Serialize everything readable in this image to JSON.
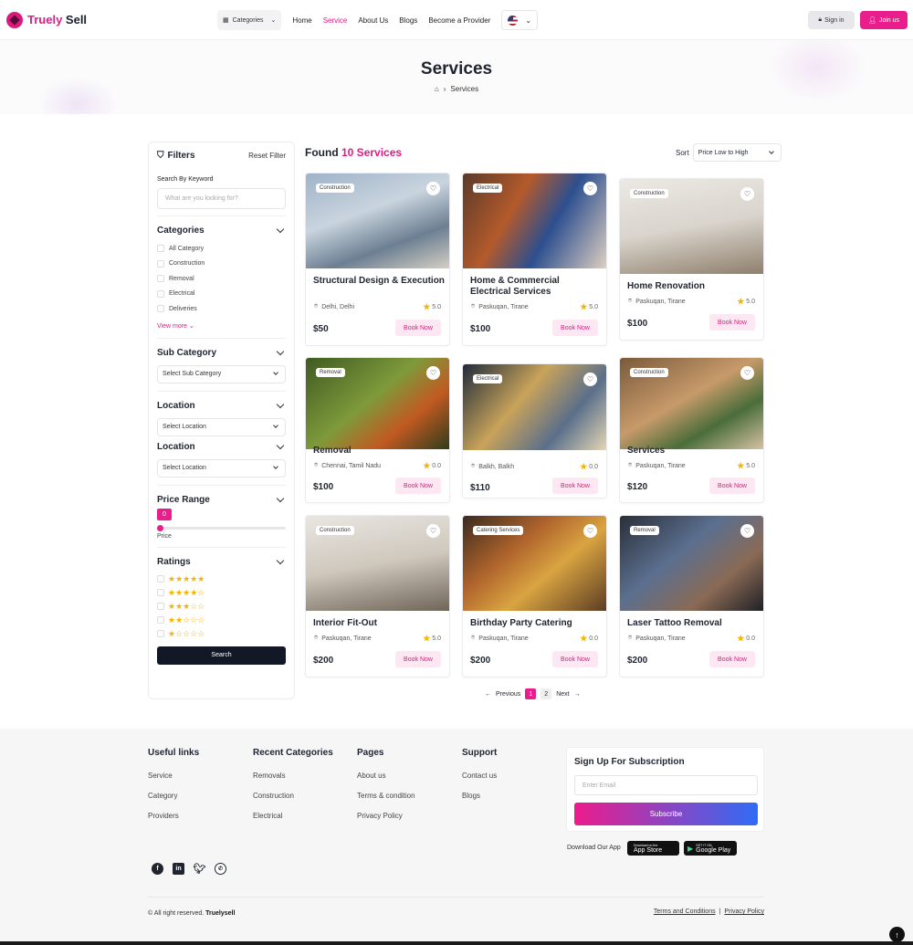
{
  "header": {
    "logo_text_1": "Truely",
    "logo_text_2": "Sell",
    "categories_label": "Categories",
    "nav": [
      "Home",
      "Service",
      "About Us",
      "Blogs",
      "Become a Provider"
    ],
    "signin": "Sign in",
    "joinus": "Join us"
  },
  "hero": {
    "title": "Services",
    "breadcrumb": "Services"
  },
  "filters": {
    "title": "Filters",
    "reset": "Reset Filter",
    "keyword_label": "Search By Keyword",
    "keyword_placeholder": "What are you looking for?",
    "categories_title": "Categories",
    "categories": [
      "All Category",
      "Construction",
      "Removal",
      "Electrical",
      "Deliveries"
    ],
    "view_more": "View more",
    "subcategory_title": "Sub Category",
    "subcategory_select": "Select Sub Category",
    "location_title_1": "Location",
    "location_select_1": "Select Location",
    "location_title_2": "Location",
    "location_select_2": "Select Location",
    "price_title": "Price Range",
    "price_value": "0",
    "price_fraction": 0,
    "price_label": "Price",
    "ratings_title": "Ratings",
    "ratings": [
      "★★★★★",
      "★★★★☆",
      "★★★☆☆",
      "★★☆☆☆",
      "★☆☆☆☆"
    ],
    "search": "Search"
  },
  "results": {
    "found_prefix": "Found",
    "found_count": "10 Services",
    "sort_label": "Sort",
    "sort_value": "Price Low to High"
  },
  "cards": [
    {
      "tag": "Construction",
      "title": "Structural Design & Execution",
      "location": "Delhi, Delhi",
      "rating": "5.0",
      "price": "$50",
      "book": "Book Now"
    },
    {
      "tag": "Electrical",
      "title": "Home & Commercial Electrical Services",
      "location": "Paskuqan, Tirane",
      "rating": "5.0",
      "price": "$100",
      "book": "Book Now"
    },
    {
      "tag": "Construction",
      "title": "Home Renovation",
      "location": "Paskuqan, Tirane",
      "rating": "5.0",
      "price": "$100",
      "book": "Book Now"
    },
    {
      "tag": "Removal",
      "title": "Removal",
      "location": "Chennai, Tamil Nadu",
      "rating": "0.0",
      "price": "$100",
      "book": "Book Now"
    },
    {
      "tag": "Electrical",
      "title": "",
      "location": "Balkh, Balkh",
      "rating": "0.0",
      "price": "$110",
      "book": "Book Now"
    },
    {
      "tag": "Construction",
      "title": "Services",
      "location": "Paskuqan, Tirane",
      "rating": "5.0",
      "price": "$120",
      "book": "Book Now"
    },
    {
      "tag": "Construction",
      "title": "Interior Fit-Out",
      "location": "Paskuqan, Tirane",
      "rating": "5.0",
      "price": "$200",
      "book": "Book Now"
    },
    {
      "tag": "Catering Services",
      "title": "Birthday Party Catering",
      "location": "Paskuqan, Tirane",
      "rating": "0.0",
      "price": "$200",
      "book": "Book Now"
    },
    {
      "tag": "Removal",
      "title": "Laser Tattoo Removal",
      "location": "Paskuqan, Tirane",
      "rating": "0.0",
      "price": "$200",
      "book": "Book Now"
    }
  ],
  "pagination": {
    "previous": "Previous",
    "pages": [
      "1",
      "2"
    ],
    "next": "Next"
  },
  "footer": {
    "col1_title": "Useful links",
    "col1": [
      "Service",
      "Category",
      "Providers"
    ],
    "col2_title": "Recent Categories",
    "col2": [
      "Removals",
      "Construction",
      "Electrical"
    ],
    "col3_title": "Pages",
    "col3": [
      "About us",
      "Terms & condition",
      "Privacy Policy"
    ],
    "col4_title": "Support",
    "col4": [
      "Contact us",
      "Blogs"
    ],
    "sub_title": "Sign Up For Subscription",
    "sub_placeholder": "Enter Email",
    "sub_button": "Subscribe",
    "app_label": "Download Our App",
    "appstore_small": "Download on the",
    "appstore": "App Store",
    "gplay_small": "GET IT ON",
    "gplay": "Google Play",
    "copyright_prefix": "© All right reserved.",
    "copyright_brand": "Truelysell",
    "terms": "Terms and Conditions",
    "privacy": "Privacy Policy"
  }
}
